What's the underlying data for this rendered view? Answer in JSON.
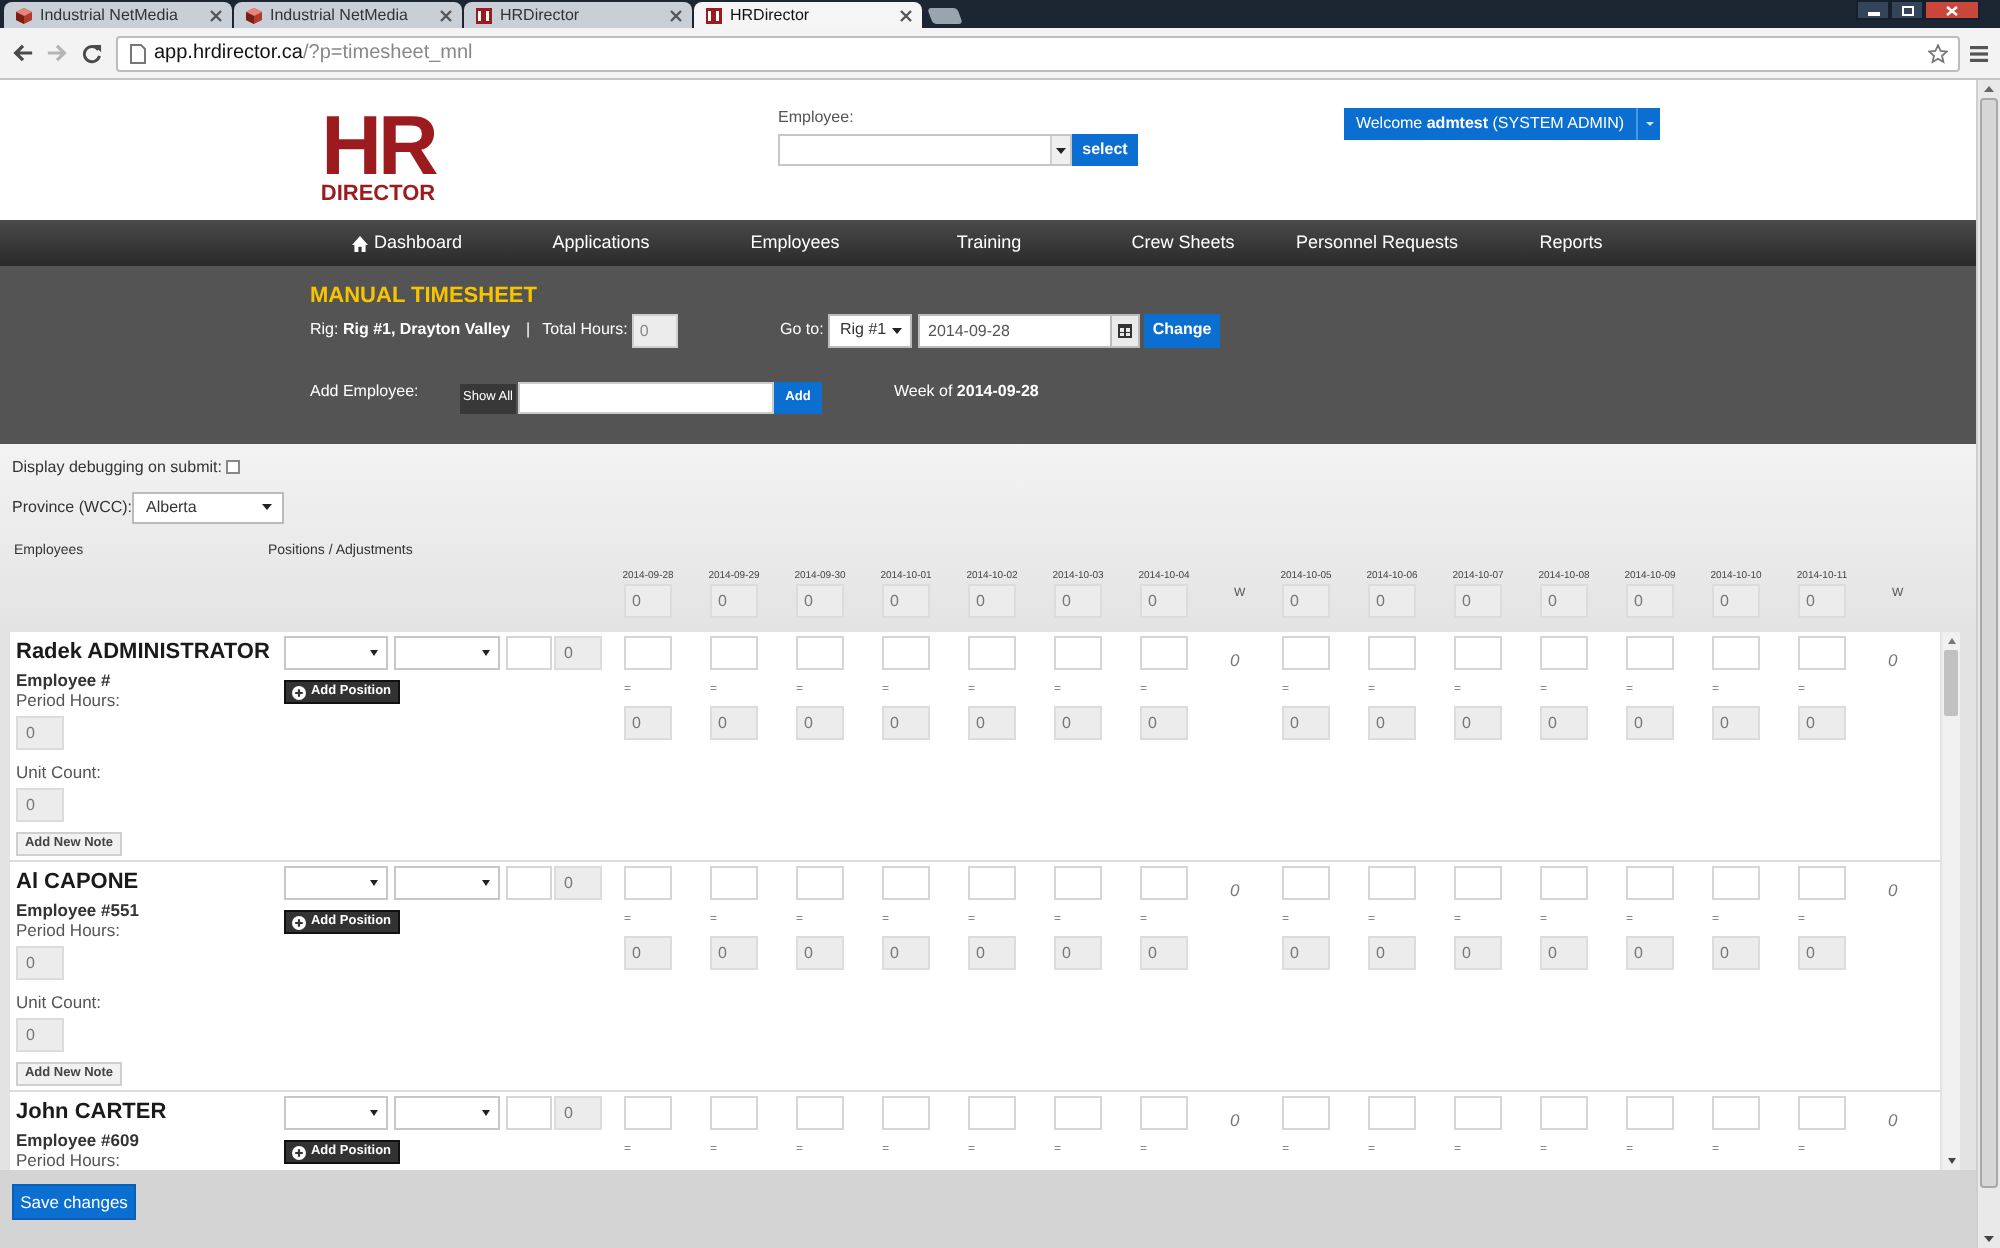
{
  "browser": {
    "tabs": [
      {
        "title": "Industrial NetMedia",
        "kind": "cube",
        "selected": false
      },
      {
        "title": "Industrial NetMedia",
        "kind": "cube",
        "selected": false
      },
      {
        "title": "HRDirector",
        "kind": "hr",
        "selected": false
      },
      {
        "title": "HRDirector",
        "kind": "hr",
        "selected": true
      }
    ],
    "url": {
      "host": "app.hrdirector.ca",
      "path": "/?p=timesheet_mnl"
    }
  },
  "header": {
    "logo": {
      "letters": "HR",
      "word": "DIRECTOR"
    },
    "employee": {
      "label": "Employee:",
      "button": "select"
    },
    "welcome": "Welcome **admtest** (SYSTEM ADMIN)"
  },
  "nav": [
    {
      "label": "Dashboard",
      "kind": "home"
    },
    {
      "label": "Applications",
      "kind": "link"
    },
    {
      "label": "Employees",
      "kind": "link"
    },
    {
      "label": "Training",
      "kind": "link"
    },
    {
      "label": "Crew Sheets",
      "kind": "link"
    },
    {
      "label": "Personnel Requests",
      "kind": "link"
    },
    {
      "label": "Reports",
      "kind": "link"
    }
  ],
  "timesheet": {
    "title": "MANUAL TIMESHEET",
    "rig": "Rig: **Rig #1, Drayton Valley**",
    "separator": "|",
    "total_hours_label": "Total Hours:",
    "total_hours": "0",
    "goto_label": "Go to:",
    "rig_select": "Rig #1",
    "date": "2014-09-28",
    "change_button": "Change",
    "add_employee_label": "Add Employee:",
    "show_all_button": "Show All",
    "add_button": "Add",
    "week": "Week of **2014-09-28**"
  },
  "options": {
    "debug_label": "Display debugging on submit:",
    "debug_checked": false,
    "province_label": "Province (WCC):",
    "province": "Alberta"
  },
  "columns": {
    "employees": "Employees",
    "positions": "Positions / Adjustments",
    "weeks": [
      {
        "days": [
          {
            "date": "2014-09-28",
            "hours": "0"
          },
          {
            "date": "2014-09-29",
            "hours": "0"
          },
          {
            "date": "2014-09-30",
            "hours": "0"
          },
          {
            "date": "2014-10-01",
            "hours": "0"
          },
          {
            "date": "2014-10-02",
            "hours": "0"
          },
          {
            "date": "2014-10-03",
            "hours": "0"
          },
          {
            "date": "2014-10-04",
            "hours": "0"
          }
        ],
        "total_label": "W"
      },
      {
        "days": [
          {
            "date": "2014-10-05",
            "hours": "0"
          },
          {
            "date": "2014-10-06",
            "hours": "0"
          },
          {
            "date": "2014-10-07",
            "hours": "0"
          },
          {
            "date": "2014-10-08",
            "hours": "0"
          },
          {
            "date": "2014-10-09",
            "hours": "0"
          },
          {
            "date": "2014-10-10",
            "hours": "0"
          },
          {
            "date": "2014-10-11",
            "hours": "0"
          }
        ],
        "total_label": "W"
      }
    ]
  },
  "employees": [
    {
      "name": "Radek ADMINISTRATOR",
      "number": "Employee #",
      "period_hours_label": "Period Hours:",
      "period_hours": "0",
      "unit_count_label": "Unit Count:",
      "unit_count": "0",
      "note_button": "Add New Note",
      "position": {
        "hours": "0",
        "button": "Add Position"
      },
      "weeks": [
        {
          "days": [
            {
              "sign": "=",
              "result": "0"
            },
            {
              "sign": "=",
              "result": "0"
            },
            {
              "sign": "=",
              "result": "0"
            },
            {
              "sign": "=",
              "result": "0"
            },
            {
              "sign": "=",
              "result": "0"
            },
            {
              "sign": "=",
              "result": "0"
            },
            {
              "sign": "=",
              "result": "0"
            }
          ],
          "total": "0"
        },
        {
          "days": [
            {
              "sign": "=",
              "result": "0"
            },
            {
              "sign": "=",
              "result": "0"
            },
            {
              "sign": "=",
              "result": "0"
            },
            {
              "sign": "=",
              "result": "0"
            },
            {
              "sign": "=",
              "result": "0"
            },
            {
              "sign": "=",
              "result": "0"
            },
            {
              "sign": "=",
              "result": "0"
            }
          ],
          "total": "0"
        }
      ]
    },
    {
      "name": "Al CAPONE",
      "number": "Employee #551",
      "period_hours_label": "Period Hours:",
      "period_hours": "0",
      "unit_count_label": "Unit Count:",
      "unit_count": "0",
      "note_button": "Add New Note",
      "position": {
        "hours": "0",
        "button": "Add Position"
      },
      "weeks": [
        {
          "days": [
            {
              "sign": "=",
              "result": "0"
            },
            {
              "sign": "=",
              "result": "0"
            },
            {
              "sign": "=",
              "result": "0"
            },
            {
              "sign": "=",
              "result": "0"
            },
            {
              "sign": "=",
              "result": "0"
            },
            {
              "sign": "=",
              "result": "0"
            },
            {
              "sign": "=",
              "result": "0"
            }
          ],
          "total": "0"
        },
        {
          "days": [
            {
              "sign": "=",
              "result": "0"
            },
            {
              "sign": "=",
              "result": "0"
            },
            {
              "sign": "=",
              "result": "0"
            },
            {
              "sign": "=",
              "result": "0"
            },
            {
              "sign": "=",
              "result": "0"
            },
            {
              "sign": "=",
              "result": "0"
            },
            {
              "sign": "=",
              "result": "0"
            }
          ],
          "total": "0"
        }
      ]
    },
    {
      "name": "John CARTER",
      "number": "Employee #609",
      "period_hours_label": "Period Hours:",
      "position": {
        "hours": "0",
        "button": "Add Position"
      },
      "weeks": [
        {
          "days": [
            {
              "sign": "="
            },
            {
              "sign": "="
            },
            {
              "sign": "="
            },
            {
              "sign": "="
            },
            {
              "sign": "="
            },
            {
              "sign": "="
            },
            {
              "sign": "="
            }
          ],
          "total": "0"
        },
        {
          "days": [
            {
              "sign": "="
            },
            {
              "sign": "="
            },
            {
              "sign": "="
            },
            {
              "sign": "="
            },
            {
              "sign": "="
            },
            {
              "sign": "="
            },
            {
              "sign": "="
            }
          ],
          "total": "0"
        }
      ]
    }
  ],
  "save_button": "Save changes"
}
